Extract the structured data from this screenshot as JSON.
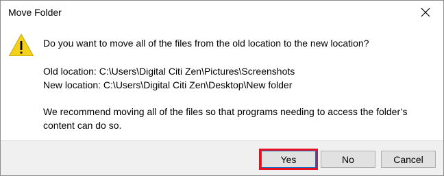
{
  "window": {
    "title": "Move Folder"
  },
  "icons": {
    "warning": "warning-icon",
    "close": "close-icon"
  },
  "message": {
    "main_instruction": "Do you want to move all of the files from the old location to the new location?",
    "old_location": "Old location: C:\\Users\\Digital Citi Zen\\Pictures\\Screenshots",
    "new_location": "New location: C:\\Users\\Digital Citi Zen\\Desktop\\New folder",
    "recommendation": "We recommend moving all of the files so that programs needing to access the folder’s content can do so."
  },
  "buttons": {
    "yes_label": "Yes",
    "no_label": "No",
    "cancel_label": "Cancel"
  },
  "colors": {
    "warning_yellow": "#f5d018",
    "highlight_red": "#e8101e",
    "focus_blue": "#0078d7",
    "footer_bg": "#f0f0f0"
  }
}
